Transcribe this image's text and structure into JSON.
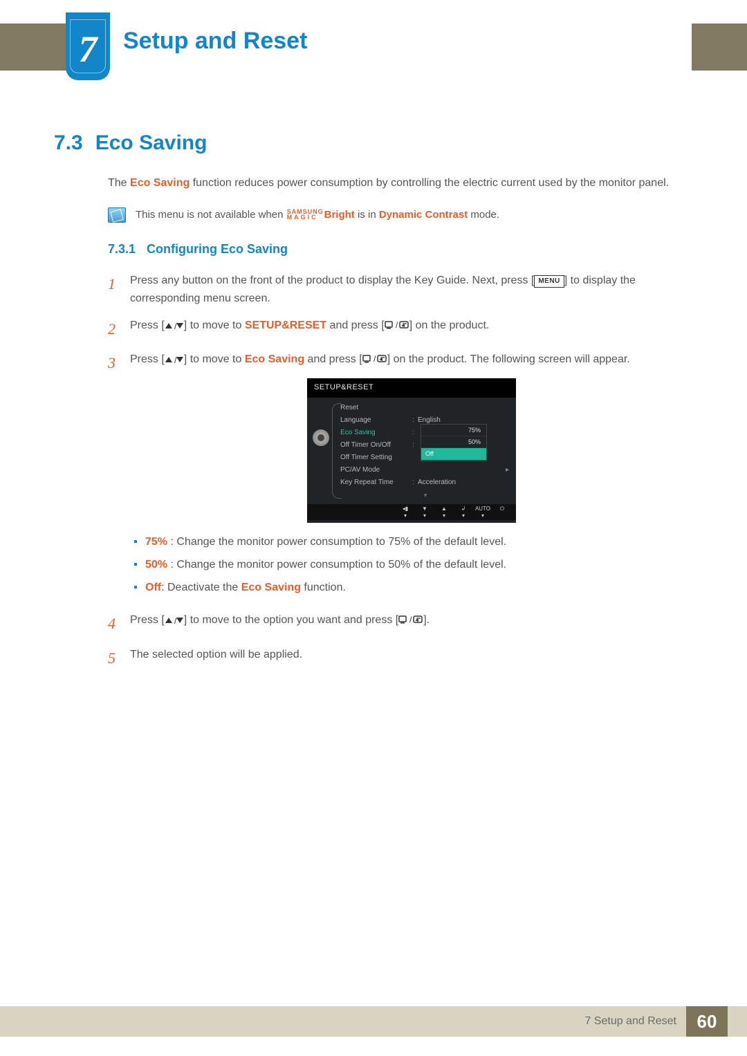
{
  "chapter": {
    "number": "7",
    "title": "Setup and Reset"
  },
  "section": {
    "number": "7.3",
    "title": "Eco Saving"
  },
  "intro": {
    "prefix": "The ",
    "term": "Eco Saving",
    "suffix": " function reduces power consumption by controlling the electric current used by the monitor panel."
  },
  "note": {
    "prefix": "This menu is not available when ",
    "magic_top": "SAMSUNG",
    "magic_bot": "MAGIC",
    "bright": "Bright",
    "mid": " is in ",
    "dyn": "Dynamic Contrast",
    "suffix": " mode."
  },
  "subsection": {
    "number": "7.3.1",
    "title": "Configuring Eco Saving"
  },
  "steps": {
    "s1": {
      "a": "Press any button on the front of the product to display the Key Guide. Next, press [",
      "menu": "MENU",
      "b": "] to display the corresponding menu screen."
    },
    "s2": {
      "a": "Press [",
      "b": "] to move to ",
      "target": "SETUP&RESET",
      "c": " and press [",
      "d": "] on the product."
    },
    "s3": {
      "a": "Press [",
      "b": "] to move to ",
      "target": "Eco Saving",
      "c": " and press [",
      "d": "] on the product. The following screen will appear."
    },
    "s4": {
      "a": "Press [",
      "b": "] to move to the option you want and press [",
      "c": "]."
    },
    "s5": "The selected option will be applied."
  },
  "bullets": {
    "b1": {
      "label": "75%",
      "text": " : Change the monitor power consumption to 75% of the default level."
    },
    "b2": {
      "label": "50%",
      "text": " : Change the monitor power consumption to 50% of the default level."
    },
    "b3": {
      "label": "Off",
      "mid": ": Deactivate the ",
      "term": "Eco Saving",
      "suffix": " function."
    }
  },
  "osd": {
    "title": "SETUP&RESET",
    "rows": {
      "reset": "Reset",
      "language": "Language",
      "language_val": "English",
      "eco": "Eco Saving",
      "off_onoff": "Off Timer On/Off",
      "off_setting": "Off Timer Setting",
      "pcav": "PC/AV Mode",
      "keyrep": "Key Repeat Time",
      "keyrep_val": "Acceleration"
    },
    "options": {
      "o75": "75%",
      "o50": "50%",
      "off": "Off"
    },
    "footer": {
      "auto": "AUTO"
    }
  },
  "footer": {
    "text": "7 Setup and Reset",
    "page": "60"
  }
}
